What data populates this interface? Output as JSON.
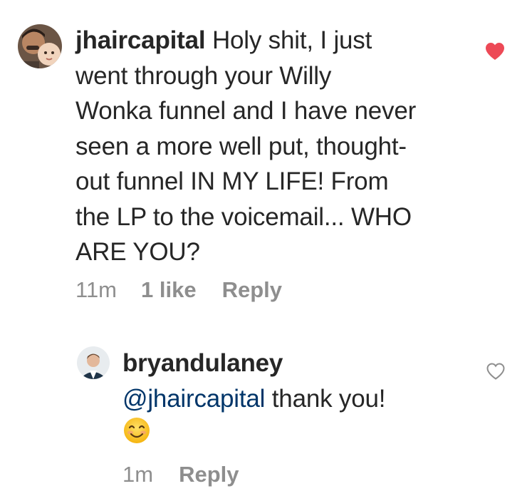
{
  "comments": [
    {
      "username": "jhaircapital",
      "text": "Holy shit, I just went through your Willy Wonka funnel and I have never seen a more well put, thought-out funnel IN MY LIFE! From the LP to the voicemail... WHO ARE YOU?",
      "lines": [
        "Holy shit, I just",
        "went through your Willy",
        "Wonka funnel and I have never",
        "seen a more well put, thought-",
        "out funnel IN MY LIFE! From",
        "the LP to the voicemail... WHO",
        "ARE YOU?"
      ],
      "time": "11m",
      "likes": "1 like",
      "reply_label": "Reply",
      "liked": true,
      "heart_color": "#ed4956"
    },
    {
      "username": "bryandulaney",
      "mention": "@jhaircapital",
      "text": "thank you!",
      "emoji_name": "smiling-face-emoji",
      "time": "1m",
      "reply_label": "Reply",
      "liked": false
    }
  ],
  "colors": {
    "text": "#262626",
    "muted": "#8e8e8e",
    "mention": "#003569",
    "heart_liked": "#ed4956"
  }
}
